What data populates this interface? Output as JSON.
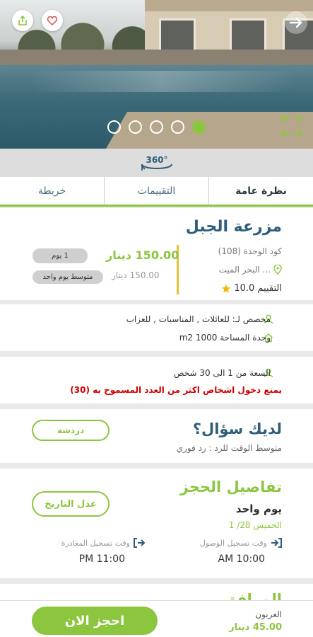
{
  "tabs": [
    {
      "label": "نظرة عامة"
    },
    {
      "label": "التقييمات"
    },
    {
      "label": "خريطة"
    }
  ],
  "listing": {
    "name": "مزرعة الجبل",
    "unit_code": "كود الوحدة (108)",
    "location": "... البحر الميت",
    "rating_label": "التقييم 10.0",
    "price_main": "150.00 دينار",
    "price_avg": "150.00 دينار",
    "badge_days": "1 يوم",
    "badge_avg": "متوسط يوم واحد"
  },
  "features": {
    "dedicated": "مخصص لـ:  للعائلات ,  المناسبات , للعزاب",
    "area": "وحدة المساحة 1000 m2"
  },
  "capacity": {
    "range": "السعة من 1  الى 30 شخص",
    "warning": "يمنع دخول اشخاص اكثر من العدد المسموح به (30)"
  },
  "question": {
    "title": "لديك سؤال؟",
    "response": "متوسط الوقت للرد :  رد فوري",
    "chat_label": "دردشة"
  },
  "booking": {
    "title": "تفاصيل الحجز",
    "duration": "يوم واحد",
    "date": "الخميس 28/ 1",
    "edit_date": "عدل التاريخ",
    "checkin_label": "وقت تسجيل الوصول",
    "checkin_time": "10:00 AM",
    "checkout_label": "وقت تسجيل المغادرة",
    "checkout_time": "11:00 PM"
  },
  "next_section": {
    "partial_title": "المرافق"
  },
  "footer": {
    "deposit_label": "العربون",
    "deposit_value": "45.00 دينار",
    "book_label": "احجز الان"
  },
  "icons": {
    "share": "share-icon",
    "favorite": "heart-icon",
    "next": "arrow-right-icon",
    "fullscreen": "fullscreen-icon",
    "view360": "360-view-icon",
    "location": "map-pin-icon",
    "star": "star-icon",
    "user": "user-icon",
    "home": "home-icon",
    "checkin": "login-icon",
    "checkout": "logout-icon"
  },
  "colors": {
    "accent": "#8cc63f",
    "heading": "#2f5e7a",
    "warning": "#d00000",
    "badge": "#cfcfcf",
    "price_divider": "#e2c236"
  },
  "gallery": {
    "page_count": 5,
    "active_index": 4
  }
}
